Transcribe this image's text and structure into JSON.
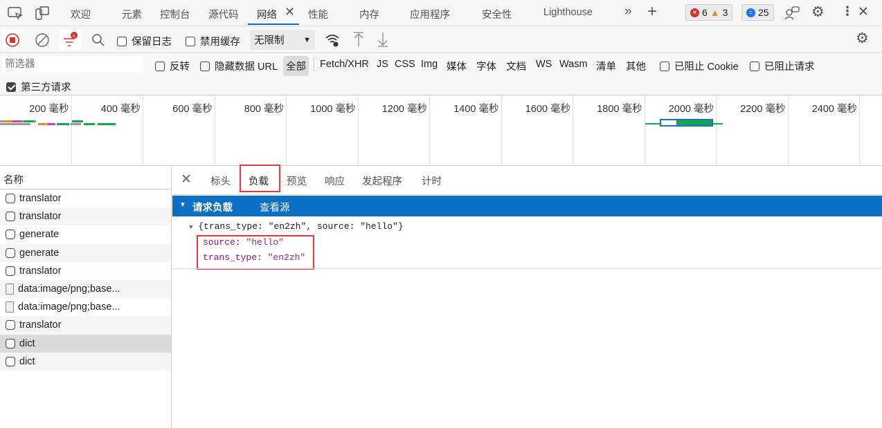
{
  "tabbar": {
    "tabs": [
      "欢迎",
      "元素",
      "控制台",
      "源代码",
      "网络",
      "性能",
      "内存",
      "应用程序",
      "安全性",
      "Lighthouse"
    ],
    "active": "网络",
    "errors": "6",
    "warnings": "3",
    "messages": "25",
    "icons": [
      "inspect-icon",
      "device-icon",
      "more-tabs-icon",
      "add-tab-icon",
      "feedback-icon",
      "settings-icon",
      "kebab-menu-icon",
      "close-icon"
    ]
  },
  "toolbar": {
    "preserve_log": "保留日志",
    "disable_cache": "禁用缓存",
    "throttle": "无限制"
  },
  "filter": {
    "placeholder": "筛选器",
    "invert": "反转",
    "hide_data_urls": "隐藏数据 URL",
    "types": [
      "全部",
      "Fetch/XHR",
      "JS",
      "CSS",
      "Img",
      "媒体",
      "字体",
      "文档",
      "WS",
      "Wasm",
      "清单",
      "其他"
    ],
    "blocked_cookies": "已阻止 Cookie",
    "blocked_requests": "已阻止请求",
    "third_party": "第三方请求",
    "third_party_checked": true
  },
  "timeline": {
    "ticks": [
      "200 毫秒",
      "400 毫秒",
      "600 毫秒",
      "800 毫秒",
      "1000 毫秒",
      "1200 毫秒",
      "1400 毫秒",
      "1600 毫秒",
      "1800 毫秒",
      "2000 毫秒",
      "2200 毫秒",
      "2400 毫秒"
    ]
  },
  "requests": {
    "header": "名称",
    "items": [
      "translator",
      "translator",
      "generate",
      "generate",
      "translator",
      "data:image/png;base...",
      "data:image/png;base...",
      "translator",
      "dict",
      "dict"
    ],
    "selected": 8
  },
  "details": {
    "tabs": [
      "标头",
      "负载",
      "预览",
      "响应",
      "发起程序",
      "计时"
    ],
    "active": "负载",
    "section": "请求负载",
    "view_source": "查看源",
    "summary": "{trans_type: \"en2zh\", source: \"hello\"}",
    "fields": [
      {
        "key": "source",
        "value": "\"hello\""
      },
      {
        "key": "trans_type",
        "value": "\"en2zh\""
      }
    ]
  },
  "colors": {
    "accent": "#0a6fc5",
    "highlight": "#e8363d"
  }
}
